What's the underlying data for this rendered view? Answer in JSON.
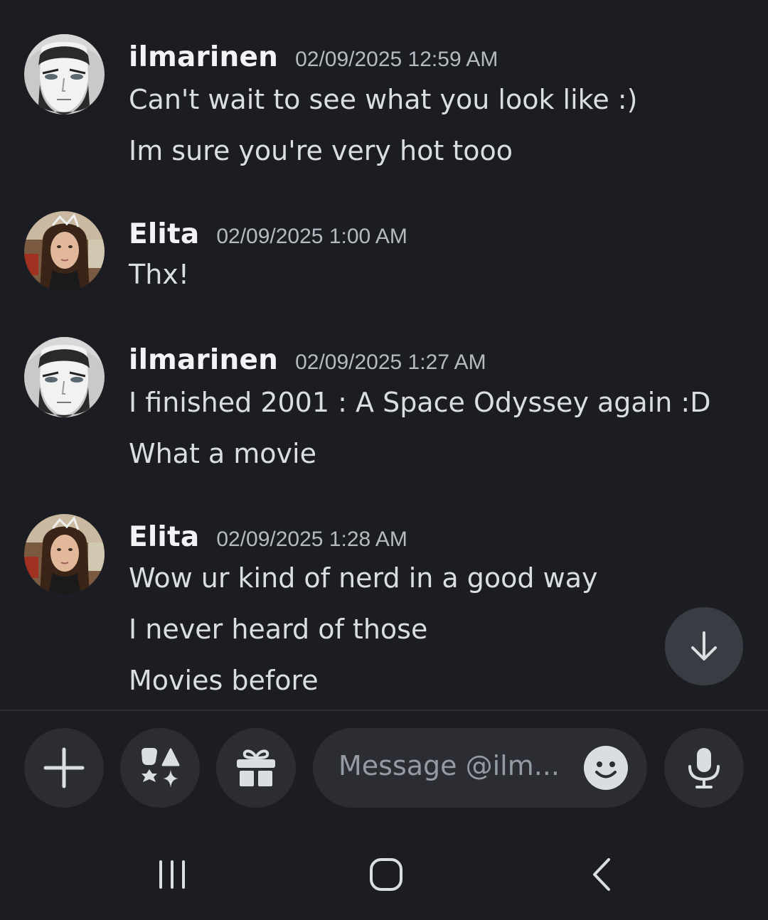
{
  "messages": [
    {
      "username": "ilmarinen",
      "timestamp": "02/09/2025 12:59 AM",
      "avatar": "anime-character-avatar",
      "lines": [
        "Can't wait to see what you look like :)",
        "Im sure you're very hot tooo"
      ]
    },
    {
      "username": "Elita",
      "timestamp": "02/09/2025 1:00 AM",
      "avatar": "woman-photo-avatar",
      "lines": [
        "Thx!"
      ]
    },
    {
      "username": "ilmarinen",
      "timestamp": "02/09/2025 1:27 AM",
      "avatar": "anime-character-avatar",
      "lines": [
        "I finished 2001 : A Space Odyssey again :D",
        "What a movie"
      ]
    },
    {
      "username": "Elita",
      "timestamp": "02/09/2025 1:28 AM",
      "avatar": "woman-photo-avatar",
      "lines": [
        "Wow ur kind of nerd in a good way",
        "I never heard of those",
        "Movies before"
      ]
    }
  ],
  "composer": {
    "placeholder": "Message @ilm...",
    "buttons": [
      "plus-icon",
      "apps-icon",
      "gift-icon",
      "emoji-icon",
      "microphone-icon"
    ]
  },
  "scroll_button": "arrow-down-icon",
  "navbar": {
    "buttons": [
      "recent-apps-icon",
      "home-icon",
      "back-icon"
    ]
  },
  "colors": {
    "background": "#1c1d22",
    "button_bg": "#2b2d33",
    "username": "#f2f3f5",
    "timestamp": "#b5bac1",
    "message_text": "#dbdee1",
    "placeholder": "#949ba4"
  }
}
